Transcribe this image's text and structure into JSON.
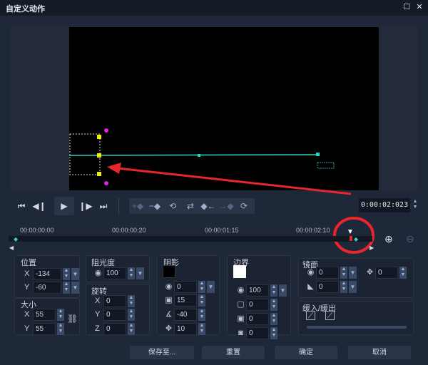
{
  "window": {
    "title": "自定义动作",
    "maximize_icon": "maximize-icon",
    "close_icon": "close-icon"
  },
  "playback": {
    "timecode": "0:00:02:023"
  },
  "timeline": {
    "labels": [
      "00:00:00:00",
      "00:00:00:20",
      "00:00:01:15",
      "00:00:02:10"
    ]
  },
  "colors": {
    "accent_cyan": "#2fd3c4",
    "highlight_red": "#e8262c",
    "keyframe_yellow": "#f2f200",
    "handle_magenta": "#e020e0"
  },
  "position": {
    "title": "位置",
    "x_label": "X",
    "x": "-134",
    "y_label": "Y",
    "y": "-60"
  },
  "size": {
    "title": "大小",
    "x_label": "X",
    "x": "55",
    "y_label": "Y",
    "y": "55"
  },
  "opacity": {
    "title": "阻光度",
    "value": "100"
  },
  "rotation": {
    "title": "旋转",
    "x_label": "X",
    "x": "0",
    "y_label": "Y",
    "y": "0",
    "z_label": "Z",
    "z": "0"
  },
  "shadow": {
    "title": "阴影",
    "opacity": "0",
    "blur": "15",
    "angle": "-40",
    "distance": "10"
  },
  "border": {
    "title": "边界",
    "opacity": "100",
    "width": "0",
    "blur": "0",
    "inner": "0"
  },
  "mirror": {
    "title": "镜面",
    "opacity": "0",
    "offset": "0",
    "fade": "0"
  },
  "ease": {
    "title": "缓入/缓出"
  },
  "buttons": {
    "save_to": "保存至...",
    "reset": "重置",
    "ok": "确定",
    "cancel": "取消"
  }
}
